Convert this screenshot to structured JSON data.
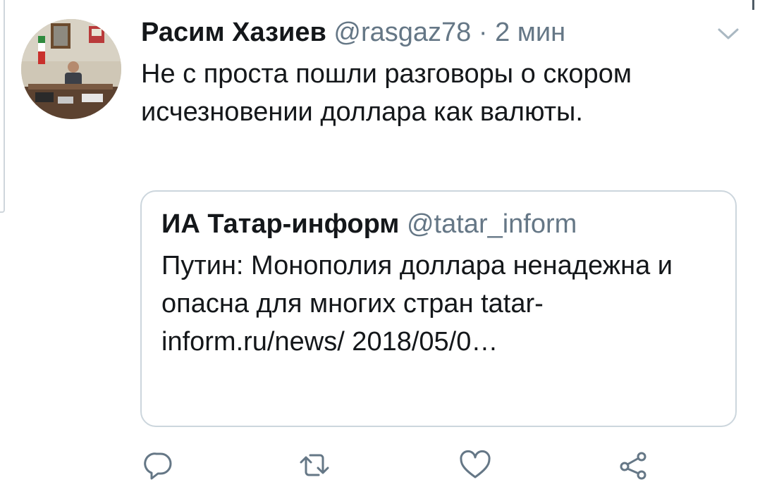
{
  "tweet": {
    "author": {
      "name": "Расим Хазиев",
      "handle": "@rasgaz78",
      "separator": " · ",
      "time": "2 мин"
    },
    "text": "Не с проста пошли разговоры о скором исчезновении доллара как валюты.",
    "quoted": {
      "name": "ИА Татар-информ",
      "handle": "@tatar_inform",
      "text": "Путин: Монополия доллара ненадежна и опасна для многих стран tatar-inform.ru/news/ 2018/05/0…"
    }
  },
  "icons": {
    "caret": "chevron-down-icon",
    "reply": "reply-icon",
    "retweet": "retweet-icon",
    "like": "heart-icon",
    "share": "share-icon"
  },
  "colors": {
    "text": "#14171a",
    "secondary": "#657786",
    "border": "#ccd6dd",
    "icon": "#657786"
  }
}
